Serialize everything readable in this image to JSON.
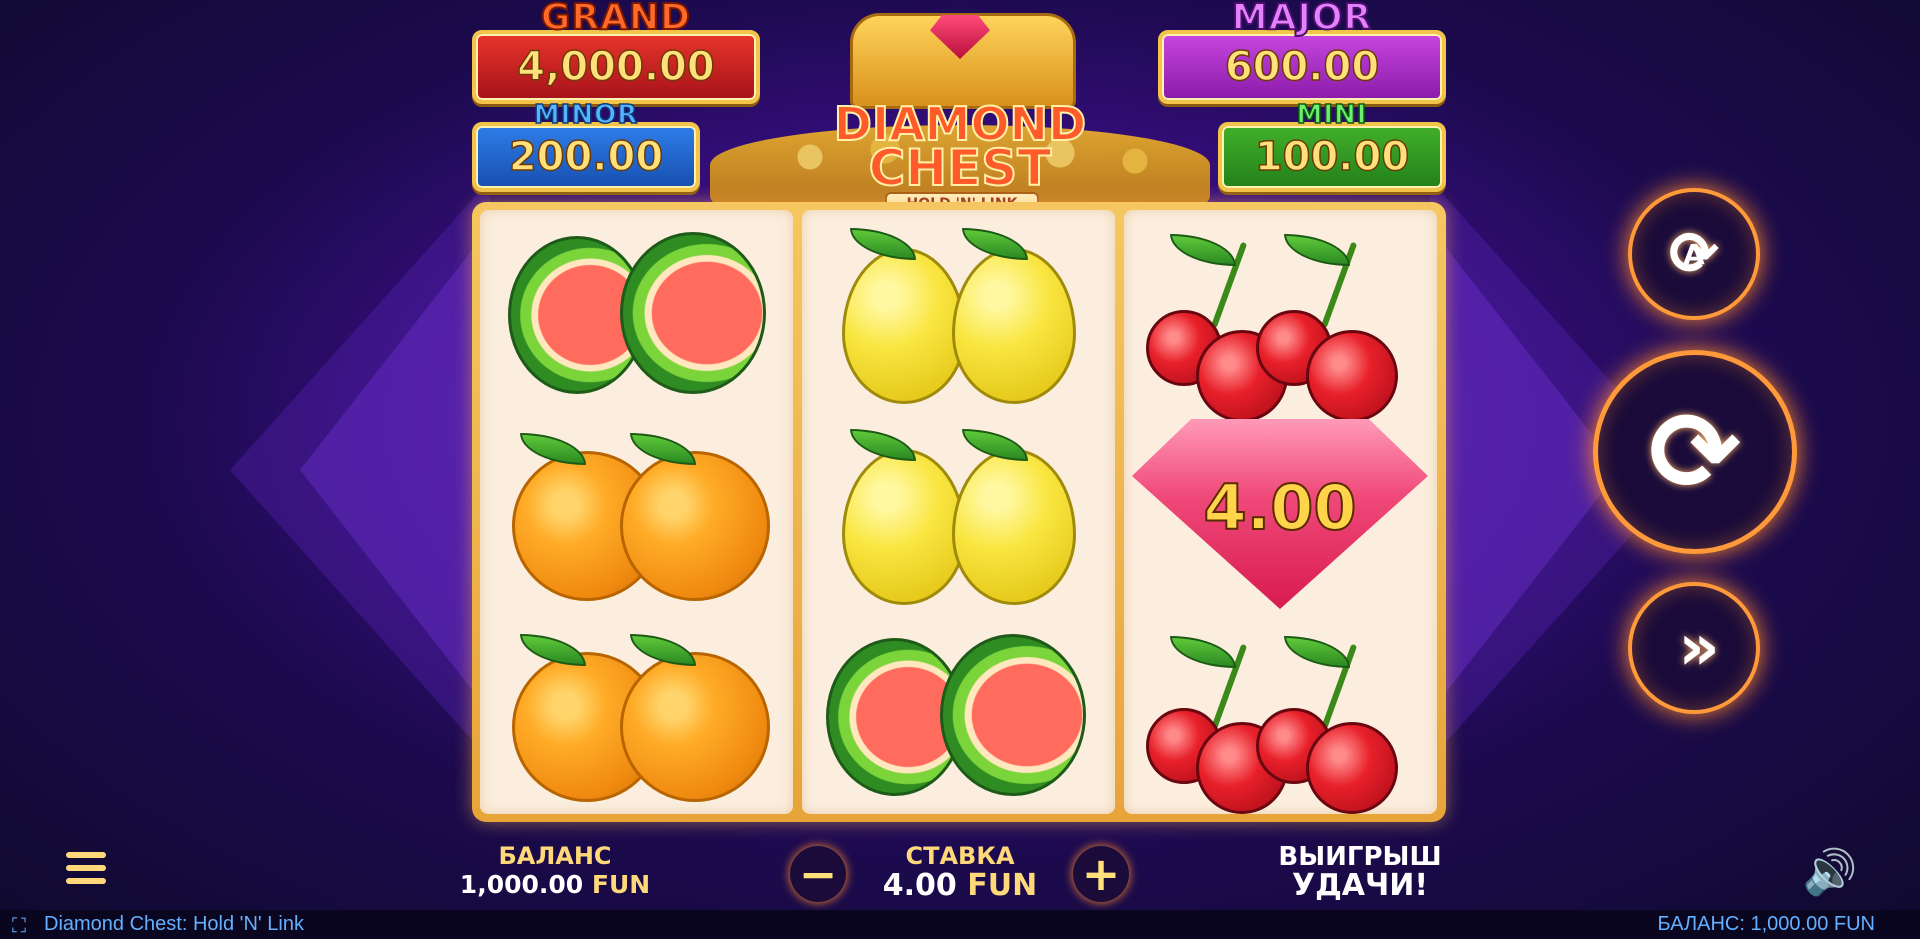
{
  "jackpots": {
    "grand": {
      "title": "GRAND",
      "value": "4,000.00"
    },
    "major": {
      "title": "MAJOR",
      "value": "600.00"
    },
    "minor": {
      "title": "MINOR",
      "value": "200.00"
    },
    "mini": {
      "title": "MINI",
      "value": "100.00"
    }
  },
  "logo": {
    "line1": "DIAMOND",
    "line2": "CHEST",
    "line3": "HOLD 'N' LINK"
  },
  "reels": [
    [
      "watermelon",
      "orange",
      "orange"
    ],
    [
      "lemon",
      "lemon",
      "watermelon"
    ],
    [
      "cherry",
      "diamond",
      "cherry"
    ]
  ],
  "diamond_value": "4.00",
  "controls": {
    "autoplay_icon": "autoplay-icon",
    "spin_icon": "spin-icon",
    "turbo_icon": "turbo-icon",
    "autoplay_letter": "A"
  },
  "bottom": {
    "balance_label": "БАЛАНС",
    "balance_value": "1,000.00",
    "currency": "FUN",
    "bet_label": "СТАВКА",
    "bet_value": "4.00",
    "win_label": "ВЫИГРЫШ",
    "win_value": "УДАЧИ!",
    "minus": "−",
    "plus": "+"
  },
  "status_bar": {
    "game_name": "Diamond Chest: Hold 'N' Link",
    "balance": "БАЛАНС: 1,000.00 FUN"
  },
  "colors": {
    "accent": "#ff9a3a",
    "label": "#ffd87a",
    "status_text": "#62b0ff"
  }
}
